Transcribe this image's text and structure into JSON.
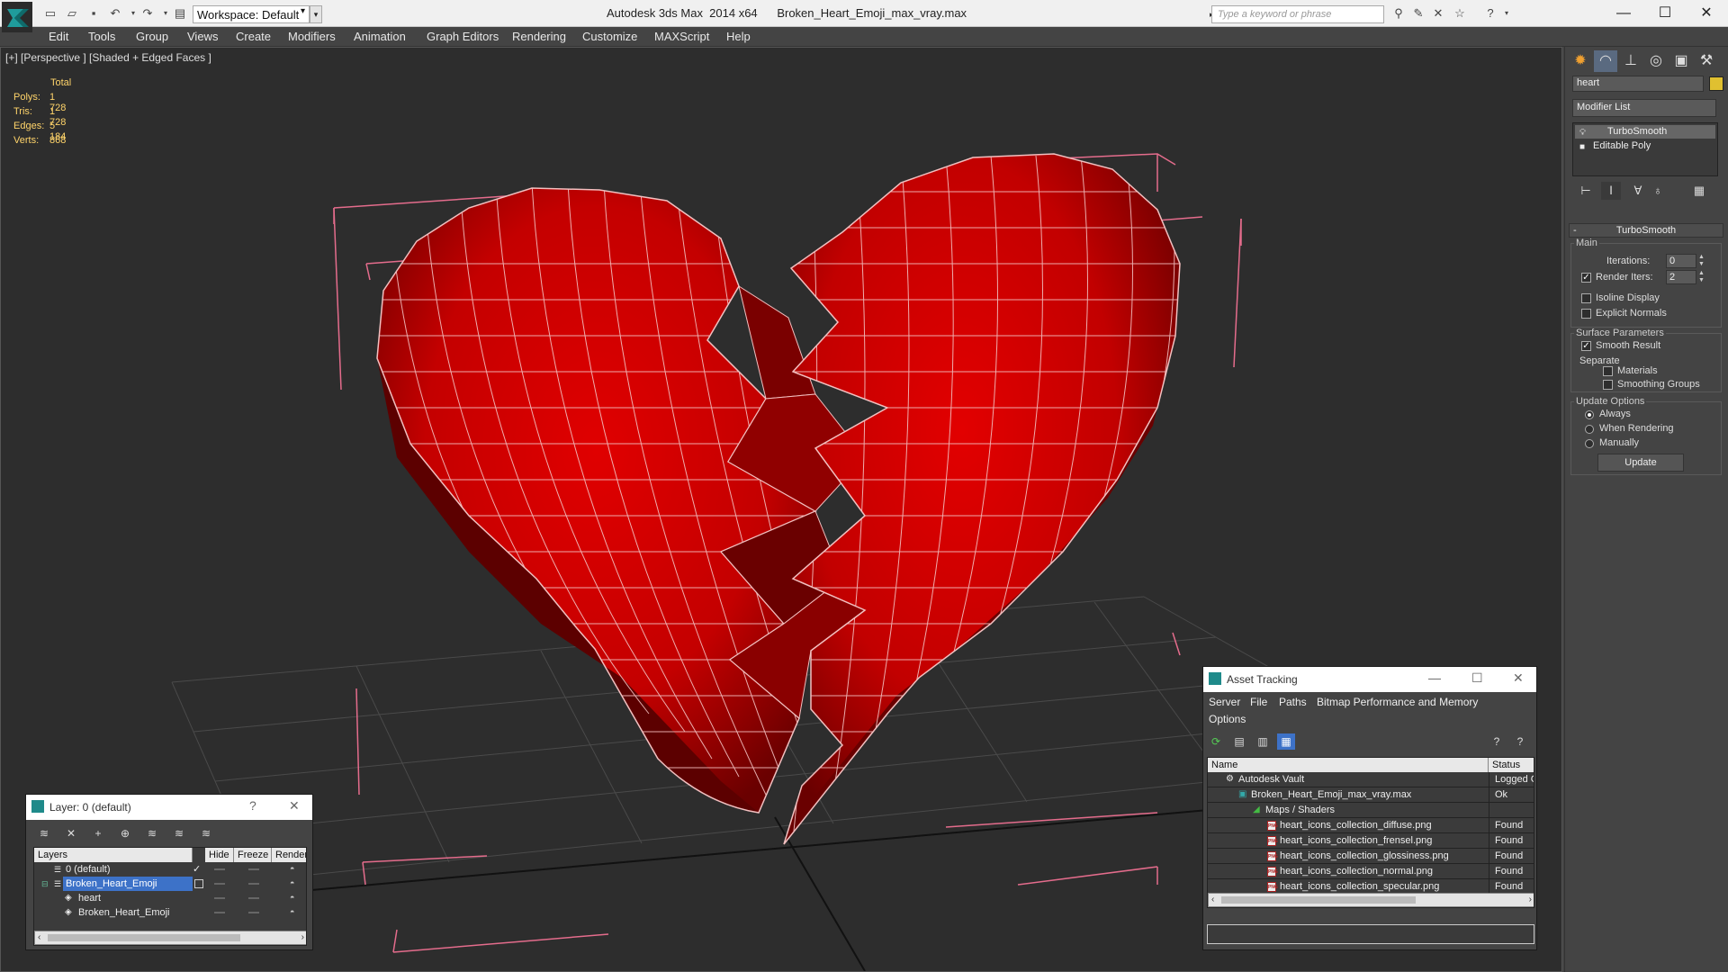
{
  "titlebar": {
    "workspace": "Workspace: Default",
    "title": "Autodesk 3ds Max  2014 x64      Broken_Heart_Emoji_max_vray.max",
    "search_placeholder": "Type a keyword or phrase"
  },
  "menu": [
    "Edit",
    "Tools",
    "Group",
    "Views",
    "Create",
    "Modifiers",
    "Animation",
    "Graph Editors",
    "Rendering",
    "Customize",
    "MAXScript",
    "Help"
  ],
  "viewport": {
    "label": "[+] [Perspective ] [Shaded + Edged Faces ]",
    "stats_header": "Total",
    "stats": [
      {
        "key": "Polys:",
        "value": "1 728"
      },
      {
        "key": "Tris:",
        "value": "1 728"
      },
      {
        "key": "Edges:",
        "value": "5 184"
      },
      {
        "key": "Verts:",
        "value": "868"
      }
    ]
  },
  "command_panel": {
    "object_name": "heart",
    "object_color": "#e0c030",
    "modifier_list": "Modifier List",
    "stack": [
      "TurboSmooth",
      "Editable Poly"
    ],
    "rollout_title": "TurboSmooth",
    "main_group": "Main",
    "iterations_label": "Iterations:",
    "iterations_value": "0",
    "render_iters_label": "Render Iters:",
    "render_iters_value": "2",
    "isoline_display": "Isoline Display",
    "explicit_normals": "Explicit Normals",
    "surface_parameters": "Surface Parameters",
    "smooth_result": "Smooth Result",
    "separate": "Separate",
    "materials": "Materials",
    "smoothing_groups": "Smoothing Groups",
    "update_options": "Update Options",
    "always": "Always",
    "when_rendering": "When Rendering",
    "manually": "Manually",
    "update_button": "Update"
  },
  "layer_window": {
    "title": "Layer: 0 (default)",
    "help": "?",
    "columns": [
      "Layers",
      "Hide",
      "Freeze",
      "Render"
    ],
    "rows": [
      "0 (default)",
      "Broken_Heart_Emoji",
      "heart",
      "Broken_Heart_Emoji"
    ]
  },
  "asset_window": {
    "title": "Asset Tracking",
    "menus": [
      "Server",
      "File",
      "Paths",
      "Bitmap Performance and Memory",
      "Options"
    ],
    "columns": [
      "Name",
      "Status"
    ],
    "rows": [
      {
        "name": "Autodesk Vault",
        "status": "Logged C"
      },
      {
        "name": "Broken_Heart_Emoji_max_vray.max",
        "status": "Ok"
      },
      {
        "name": "Maps / Shaders",
        "status": ""
      },
      {
        "name": "heart_icons_collection_diffuse.png",
        "status": "Found"
      },
      {
        "name": "heart_icons_collection_frensel.png",
        "status": "Found"
      },
      {
        "name": "heart_icons_collection_glossiness.png",
        "status": "Found"
      },
      {
        "name": "heart_icons_collection_normal.png",
        "status": "Found"
      },
      {
        "name": "heart_icons_collection_specular.png",
        "status": "Found"
      }
    ]
  },
  "colors": {
    "heart_red": "#c80000",
    "wire": "#f2c0c0",
    "bbox": "#e46c8c",
    "selection": "#3d72c8"
  }
}
